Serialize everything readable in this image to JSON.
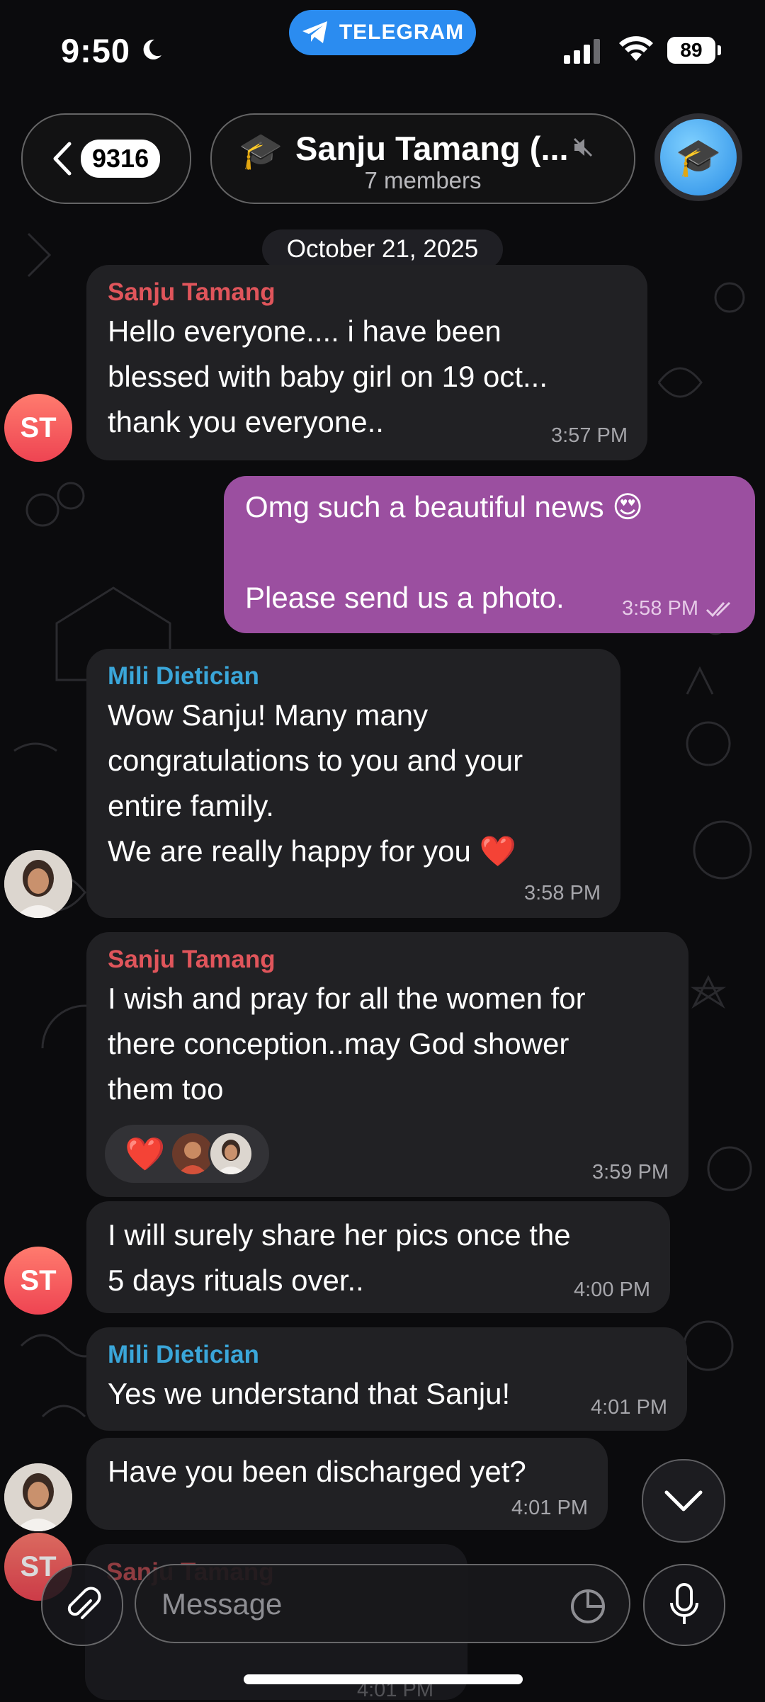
{
  "status_bar": {
    "time": "9:50",
    "app_badge": "TELEGRAM",
    "battery": "89"
  },
  "header": {
    "back_count": "9316",
    "group_emoji": "🎓",
    "group_name": "Sanju Tamang (...",
    "members": "7 members"
  },
  "date_label": "October 21, 2025",
  "messages": [
    {
      "sender": "Sanju Tamang",
      "text": "Hello everyone.... i have been\nblessed with baby girl on 19 oct...\nthank you everyone..",
      "time": "3:57 PM"
    },
    {
      "text": "Omg such a beautiful news 😍\n\nPlease send us a photo.",
      "time": "3:58 PM"
    },
    {
      "sender": "Mili Dietician",
      "text": "Wow Sanju! Many many\ncongratulations to you and your\nentire family.\nWe are really happy for you ❤️",
      "time": "3:58 PM"
    },
    {
      "sender": "Sanju Tamang",
      "text": "I wish and pray for all the women for\nthere conception..may God shower\nthem too",
      "time": "3:59 PM",
      "reaction": "❤️"
    },
    {
      "text": "I will surely share her pics once the\n5 days rituals over..",
      "time": "4:00 PM"
    },
    {
      "sender": "Mili Dietician",
      "text": "Yes we understand that Sanju!",
      "time": "4:01 PM"
    },
    {
      "text": "Have you been discharged yet?",
      "time": "4:01 PM"
    }
  ],
  "avatars": {
    "sanju_initials": "ST"
  },
  "partial": {
    "sender": "Sanju Tamang",
    "time": "4:01 PM",
    "avatar": "ST"
  },
  "composer": {
    "placeholder": "Message"
  },
  "colors": {
    "outgoing": "#9b4fa0",
    "incoming": "#212124",
    "sanju_name": "#e0555b",
    "mili_name": "#3aa6d9",
    "telegram": "#2b8cf0"
  }
}
